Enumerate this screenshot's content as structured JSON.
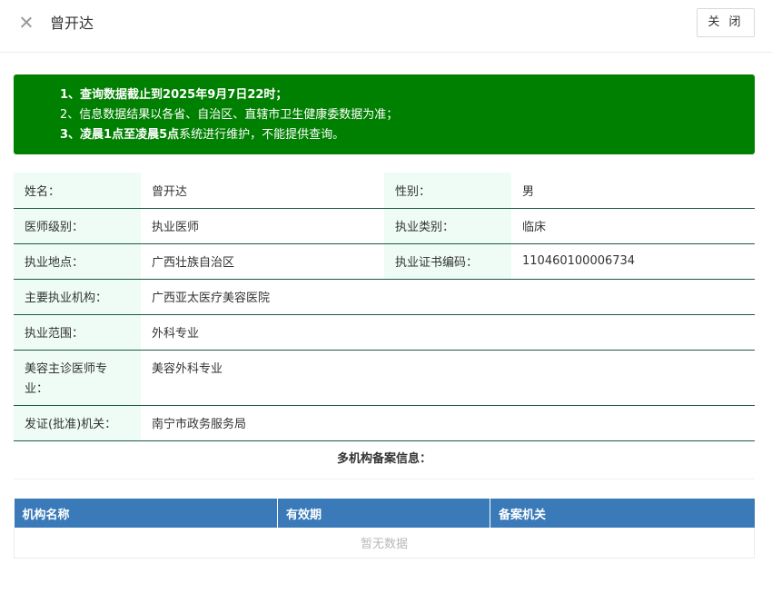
{
  "header": {
    "title": "曾开达",
    "close_button": "关 闭"
  },
  "notice": {
    "line1_prefix": "1、查询数据截止到",
    "line1_date": "2025年9月7日22时",
    "line1_suffix": "；",
    "line2": "2、信息数据结果以各省、自治区、直辖市卫生健康委数据为准；",
    "line3_bold": "3、凌晨1点至凌晨5点",
    "line3_rest": "系统进行维护，不能提供查询。"
  },
  "info": {
    "name_label": "姓名：",
    "name_value": "曾开达",
    "gender_label": "性别：",
    "gender_value": "男",
    "level_label": "医师级别：",
    "level_value": "执业医师",
    "category_label": "执业类别：",
    "category_value": "临床",
    "location_label": "执业地点：",
    "location_value": "广西壮族自治区",
    "cert_label": "执业证书编码：",
    "cert_value": "110460100006734",
    "org_label": "主要执业机构：",
    "org_value": "广西亚太医疗美容医院",
    "scope_label": "执业范围：",
    "scope_value": "外科专业",
    "cosmetic_label": "美容主诊医师专业：",
    "cosmetic_value": "美容外科专业",
    "issuer_label": "发证(批准)机关：",
    "issuer_value": "南宁市政务服务局"
  },
  "multi": {
    "title": "多机构备案信息：",
    "columns": [
      "机构名称",
      "有效期",
      "备案机关"
    ],
    "empty_text": "暂无数据"
  }
}
